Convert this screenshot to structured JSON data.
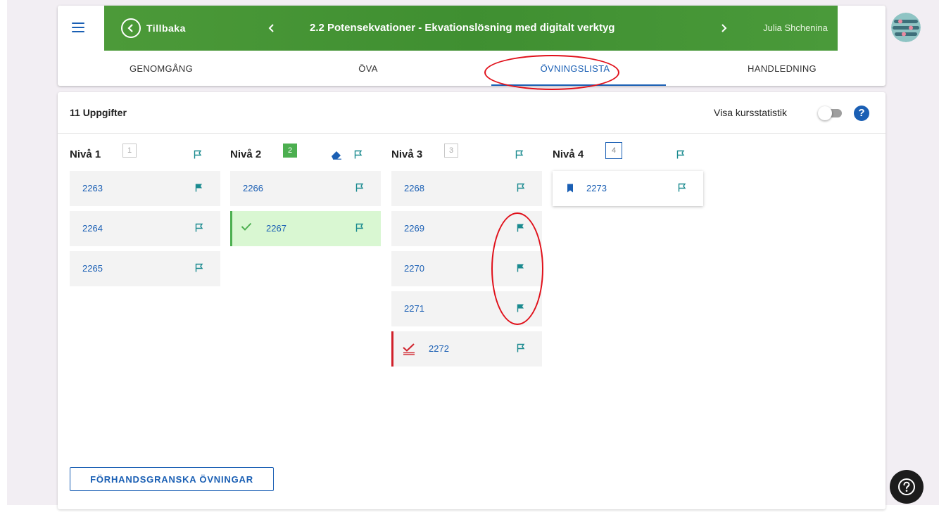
{
  "header": {
    "back_label": "Tillbaka",
    "lesson_title": "2.2 Potensekvationer - Ekvationslösning med digitalt verktyg",
    "user_name": "Julia Shchenina"
  },
  "tabs": [
    {
      "label": "GENOMGÅNG",
      "active": false
    },
    {
      "label": "ÖVA",
      "active": false
    },
    {
      "label": "ÖVNINGSLISTA",
      "active": true
    },
    {
      "label": "HANDLEDNING",
      "active": false
    }
  ],
  "main": {
    "task_count_label": "11 Uppgifter",
    "stats_label": "Visa kursstatistik",
    "stats_toggle_on": false,
    "preview_button": "FÖRHANDSGRANSKA ÖVNINGAR"
  },
  "levels": [
    {
      "title": "Nivå 1",
      "badge": "1",
      "tasks": [
        {
          "number": "2263",
          "flag": "filled"
        },
        {
          "number": "2264",
          "flag": "outline"
        },
        {
          "number": "2265",
          "flag": "outline"
        }
      ]
    },
    {
      "title": "Nivå 2",
      "badge": "2",
      "tasks": [
        {
          "number": "2266",
          "flag": "outline"
        },
        {
          "number": "2267",
          "flag": "outline",
          "status": "done"
        }
      ]
    },
    {
      "title": "Nivå 3",
      "badge": "3",
      "tasks": [
        {
          "number": "2268",
          "flag": "outline"
        },
        {
          "number": "2269",
          "flag": "filled"
        },
        {
          "number": "2270",
          "flag": "filled"
        },
        {
          "number": "2271",
          "flag": "filled"
        },
        {
          "number": "2272",
          "flag": "outline",
          "status": "marked"
        }
      ]
    },
    {
      "title": "Nivå 4",
      "badge": "4",
      "tasks": [
        {
          "number": "2273",
          "flag": "outline",
          "status": "bookmarked"
        }
      ]
    }
  ],
  "colors": {
    "accent": "#1a5fb4",
    "header_green": "#3f8f31",
    "flag_teal": "#1a8a8f",
    "done_green": "#4caf50",
    "annotation_red": "#e0101a"
  }
}
